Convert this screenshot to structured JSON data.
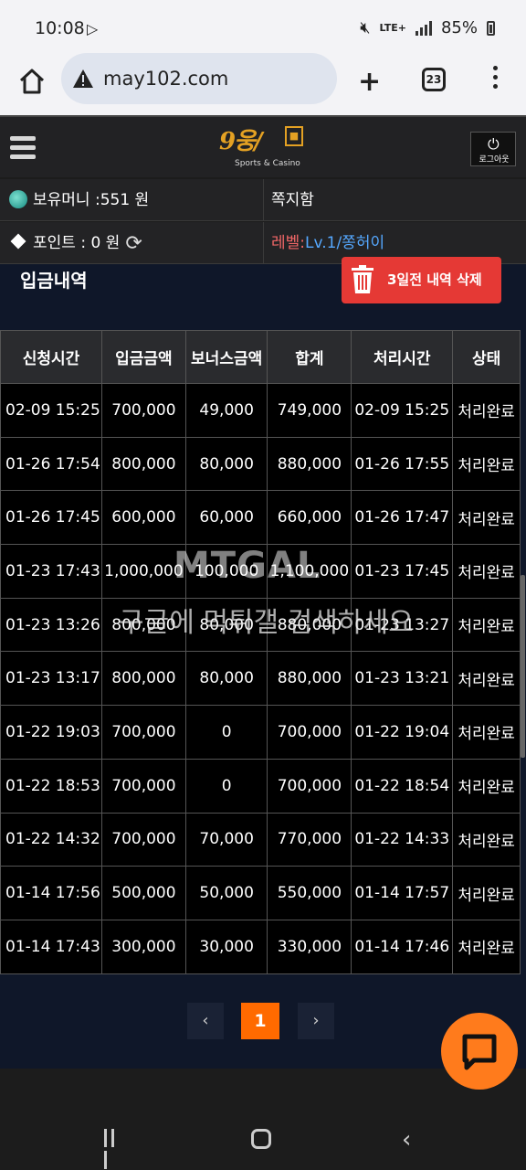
{
  "status_bar": {
    "time": "10:08",
    "network": "LTE+",
    "battery": "85%"
  },
  "browser": {
    "url": "may102.com",
    "tab_count": "23"
  },
  "header": {
    "logo_sub": "Sports & Casino",
    "logout_label": "로그아웃"
  },
  "info": {
    "money_label": "보유머니 :551 원",
    "message_label": "쪽지함",
    "point_label": "포인트 :  0 원",
    "level_label": "레벨:",
    "level_value": "Lv.1/쫑허이"
  },
  "section": {
    "title": "입금내역",
    "delete_button": "3일전 내역 삭제"
  },
  "table": {
    "headers": [
      "신청시간",
      "입금금액",
      "보너스금액",
      "합계",
      "처리시간",
      "상태"
    ],
    "rows": [
      [
        "02-09 15:25",
        "700,000",
        "49,000",
        "749,000",
        "02-09 15:25",
        "처리완료"
      ],
      [
        "01-26 17:54",
        "800,000",
        "80,000",
        "880,000",
        "01-26 17:55",
        "처리완료"
      ],
      [
        "01-26 17:45",
        "600,000",
        "60,000",
        "660,000",
        "01-26 17:47",
        "처리완료"
      ],
      [
        "01-23 17:43",
        "1,000,000",
        "100,000",
        "1,100,000",
        "01-23 17:45",
        "처리완료"
      ],
      [
        "01-23 13:26",
        "800,000",
        "80,000",
        "880,000",
        "01-23 13:27",
        "처리완료"
      ],
      [
        "01-23 13:17",
        "800,000",
        "80,000",
        "880,000",
        "01-23 13:21",
        "처리완료"
      ],
      [
        "01-22 19:03",
        "700,000",
        "0",
        "700,000",
        "01-22 19:04",
        "처리완료"
      ],
      [
        "01-22 18:53",
        "700,000",
        "0",
        "700,000",
        "01-22 18:54",
        "처리완료"
      ],
      [
        "01-22 14:32",
        "700,000",
        "70,000",
        "770,000",
        "01-22 14:33",
        "처리완료"
      ],
      [
        "01-14 17:56",
        "500,000",
        "50,000",
        "550,000",
        "01-14 17:57",
        "처리완료"
      ],
      [
        "01-14 17:43",
        "300,000",
        "30,000",
        "330,000",
        "01-14 17:46",
        "처리완료"
      ]
    ]
  },
  "pagination": {
    "prev": "‹",
    "current": "1",
    "next": "›"
  },
  "watermark": {
    "logo": "MTGAL",
    "text": "구글에 먹튀갤 검색하세요"
  },
  "colors": {
    "accent_orange": "#ff6a00",
    "delete_red": "#e53935",
    "level_blue": "#55a8ff"
  }
}
